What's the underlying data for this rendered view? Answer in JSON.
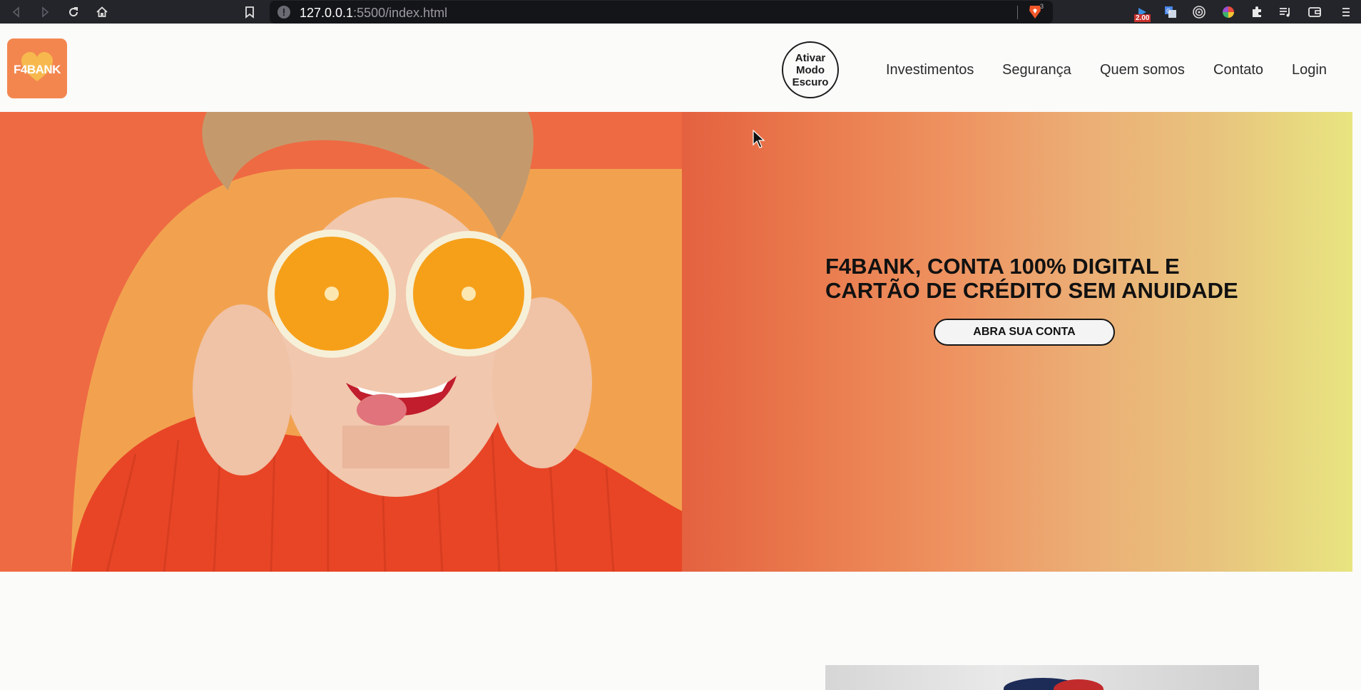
{
  "browser": {
    "url_host": "127.0.0.1",
    "url_path": ":5500/index.html",
    "brave_badge": "3",
    "ext_badge": "2.00"
  },
  "header": {
    "logo_text": "F4BANK",
    "dark_mode_label": "Ativar Modo Escuro",
    "nav": [
      "Investimentos",
      "Segurança",
      "Quem somos",
      "Contato",
      "Login"
    ]
  },
  "hero": {
    "title": "F4BANK, CONTA 100% DIGITAL E CARTÃO DE CRÉDITO SEM ANUIDADE",
    "cta": "ABRA SUA CONTA"
  },
  "colors": {
    "brand_orange": "#f3864f",
    "hero_left": "#ee6a43",
    "hero_right": "#e8e580"
  }
}
